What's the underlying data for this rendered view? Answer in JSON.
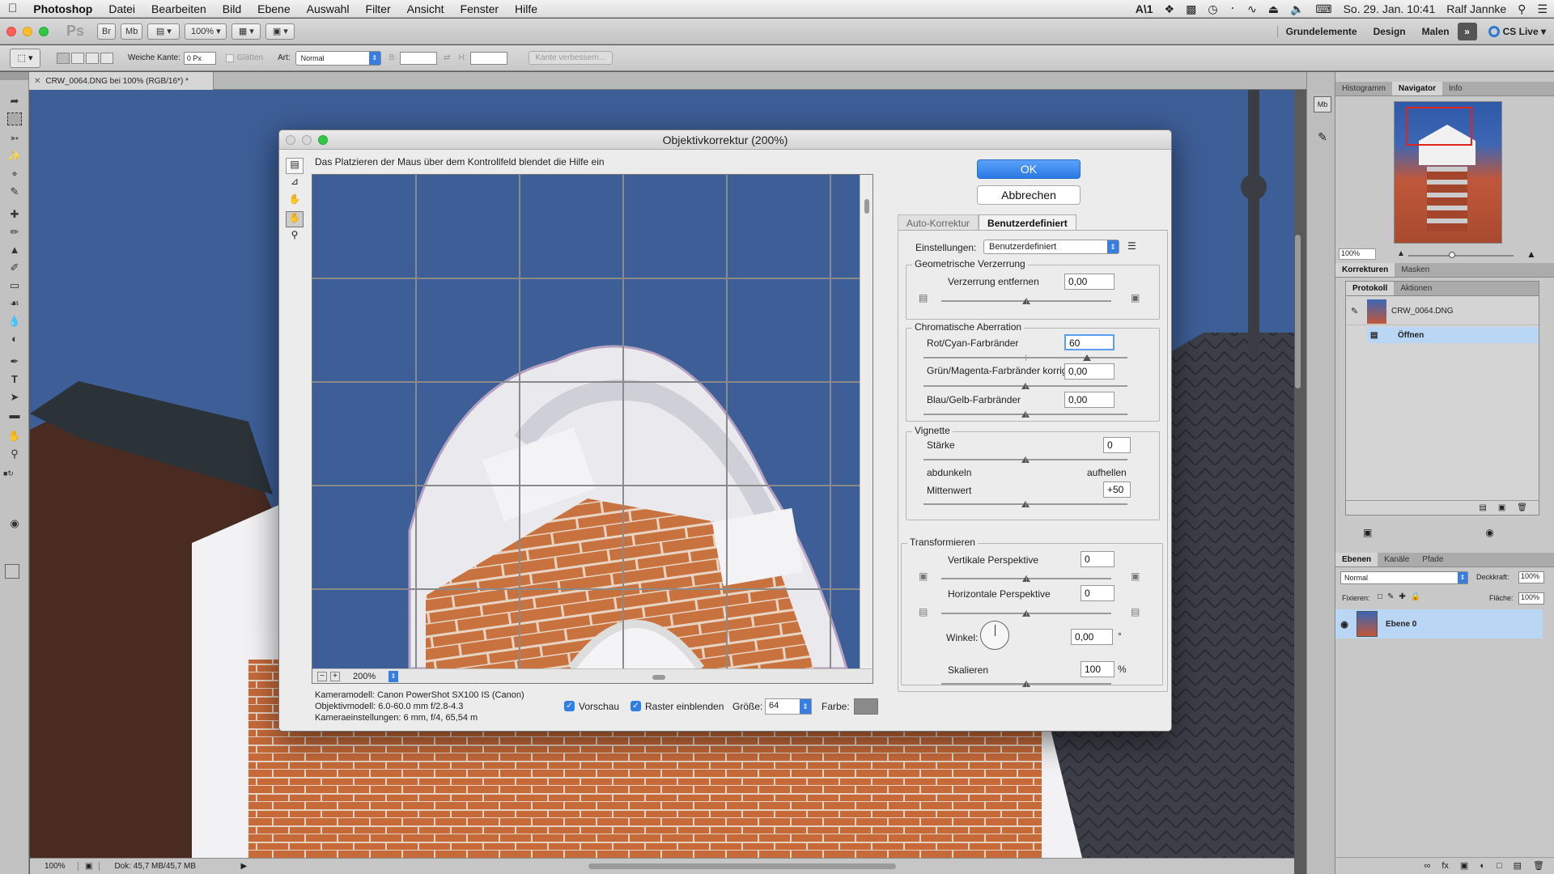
{
  "menubar": {
    "apple": "",
    "app_name": "Photoshop",
    "items": [
      "Datei",
      "Bearbeiten",
      "Bild",
      "Ebene",
      "Auswahl",
      "Filter",
      "Ansicht",
      "Fenster",
      "Hilfe"
    ],
    "clock": "So. 29. Jan.  10:41",
    "user": "Ralf Jannke",
    "status_icons": [
      "adobe-icon",
      "dropbox-icon",
      "messages-icon",
      "timemachine-icon",
      "bluetooth-icon",
      "wifi-icon",
      "eject-icon",
      "volume-icon",
      "spotlight-icon",
      "menu-icon"
    ]
  },
  "appbar": {
    "ps_logo": "Ps",
    "br_button": "Br",
    "mb_button": "Mb",
    "zoom": "100%",
    "workspaces": [
      "Grundelemente",
      "Design",
      "Malen"
    ],
    "cs_live": "CS Live"
  },
  "optionsbar": {
    "feather_label": "Weiche Kante:",
    "feather_value": "0 Px",
    "antialias_label": "Glätten",
    "style_label": "Art:",
    "style_value": "Normal",
    "width_label": "B:",
    "height_label": "H:",
    "refine_button": "Kante verbessern..."
  },
  "document": {
    "tab_title": "CRW_0064.DNG bei 100% (RGB/16*) *",
    "status_zoom": "100%",
    "status_doc": "Dok: 45,7 MB/45,7 MB"
  },
  "panels": {
    "top_tabs": [
      "Histogramm",
      "Navigator",
      "Info"
    ],
    "nav_zoom": "100%",
    "adjust_tabs": [
      "Korrekturen",
      "Masken"
    ],
    "history_tabs": [
      "Protokoll",
      "Aktionen"
    ],
    "history_snapshot": "CRW_0064.DNG",
    "history_step": "Öffnen",
    "layer_tabs": [
      "Ebenen",
      "Kanäle",
      "Pfade"
    ],
    "blend_mode": "Normal",
    "opacity_label": "Deckkraft:",
    "opacity_value": "100%",
    "lock_label": "Fixieren:",
    "fill_label": "Fläche:",
    "fill_value": "100%",
    "layer_name": "Ebene 0"
  },
  "dialog": {
    "title": "Objektivkorrektur (200%)",
    "hint": "Das Platzieren der Maus über dem Kontrollfeld blendet die Hilfe ein",
    "ok": "OK",
    "cancel": "Abbrechen",
    "tabs": [
      "Auto-Korrektur",
      "Benutzerdefiniert"
    ],
    "settings_label": "Einstellungen:",
    "settings_value": "Benutzerdefiniert",
    "geom_title": "Geometrische Verzerrung",
    "distortion_label": "Verzerrung entfernen",
    "distortion_value": "0,00",
    "distortion_level": 0.0,
    "chrom_title": "Chromatische Aberration",
    "red_cyan_label": "Rot/Cyan-Farbränder",
    "red_cyan_value": "60",
    "red_cyan_level": 0.6,
    "green_magenta_label": "Grün/Magenta-Farbränder korrig.",
    "green_magenta_value": "0,00",
    "green_magenta_level": 0.0,
    "blue_yellow_label": "Blau/Gelb-Farbränder",
    "blue_yellow_value": "0,00",
    "blue_yellow_level": 0.0,
    "vignette_title": "Vignette",
    "amount_label": "Stärke",
    "amount_value": "0",
    "amount_level": 0,
    "darken_label": "abdunkeln",
    "lighten_label": "aufhellen",
    "midpoint_label": "Mittenwert",
    "midpoint_value": "+50",
    "midpoint_level": 50,
    "transform_title": "Transformieren",
    "vertical_label": "Vertikale Perspektive",
    "vertical_value": "0",
    "vertical_level": 0,
    "horizontal_label": "Horizontale Perspektive",
    "horizontal_value": "0",
    "horizontal_level": 0,
    "angle_label": "Winkel:",
    "angle_value": "0,00",
    "angle_unit": "°",
    "scale_label": "Skalieren",
    "scale_value": "100",
    "scale_unit": "%",
    "scale_level": 100,
    "preview_zoom": "200%",
    "camera_model": "Kameramodell: Canon PowerShot SX100 IS (Canon)",
    "lens_model": "Objektivmodell: 6.0-60.0 mm f/2.8-4.3",
    "camera_settings": "Kameraeinstellungen: 6 mm, f/4, 65,54 m",
    "preview_label": "Vorschau",
    "grid_label": "Raster einblenden",
    "size_label": "Größe:",
    "size_value": "64",
    "color_label": "Farbe:",
    "grid_color": "#8a8a8a"
  },
  "colors": {
    "sky": "#3d5e97",
    "brick": "#c66a3a",
    "ok_blue": "#2f7fe6",
    "selection_blue": "#b9d6f5"
  }
}
